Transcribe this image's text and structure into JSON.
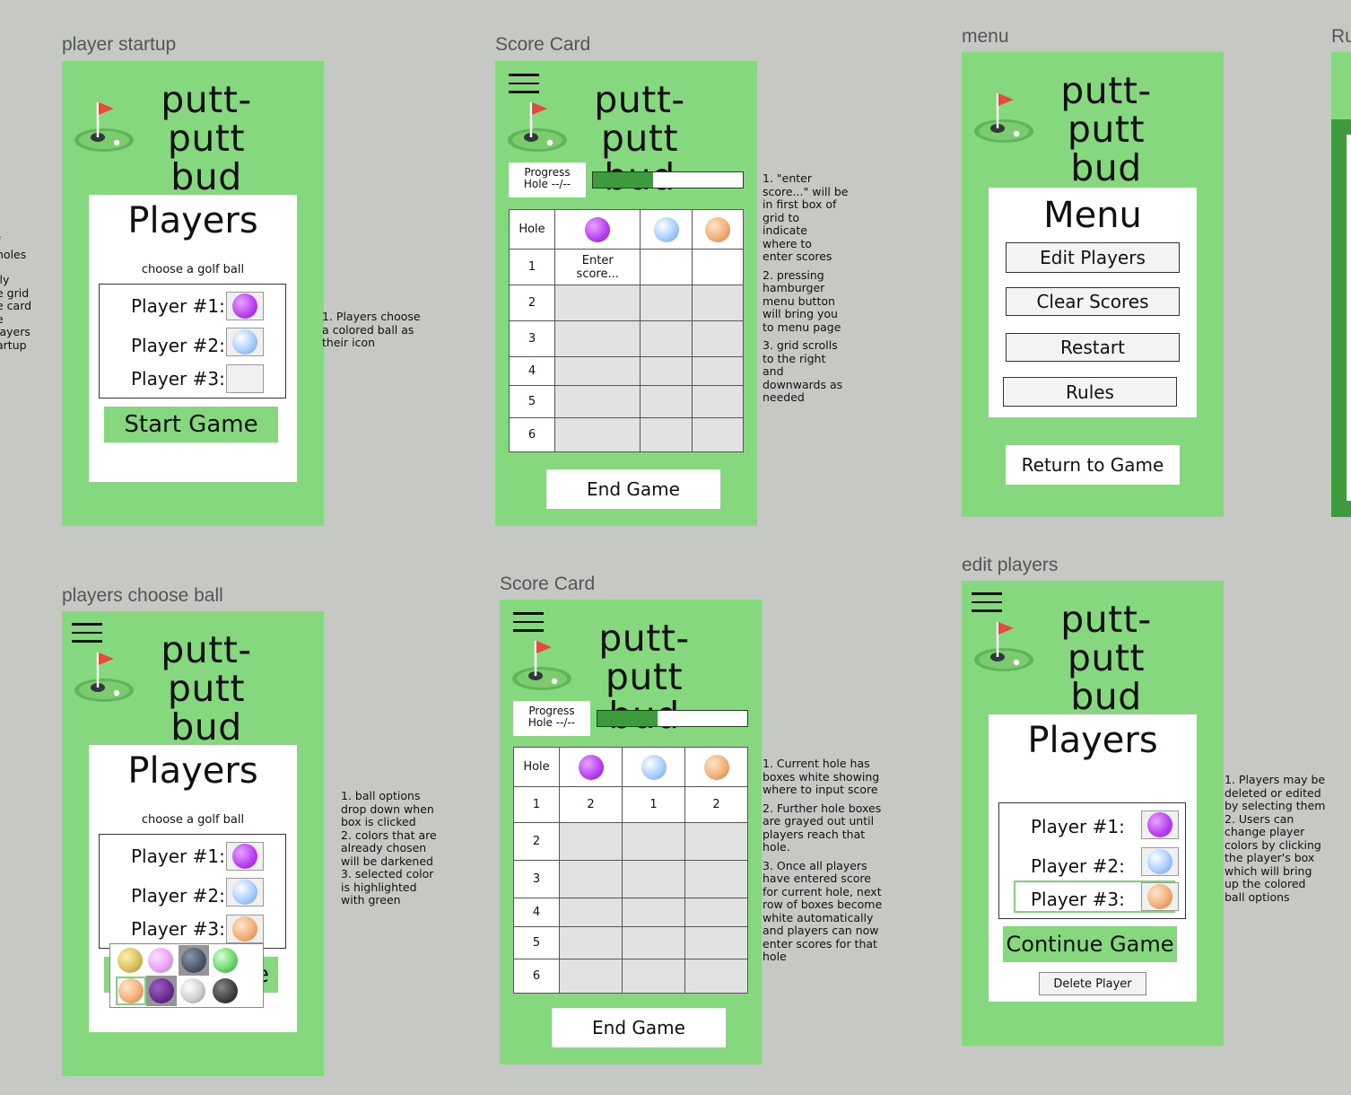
{
  "labels": {
    "startup": "player startup",
    "score1": "Score Card",
    "menu": "menu",
    "rules": "Ru",
    "choose": "players choose ball",
    "score2": "Score Card",
    "edit": "edit players"
  },
  "brand": {
    "line1": "putt-putt",
    "line2": "bud"
  },
  "players": {
    "title": "Players",
    "subtitle": "choose a golf ball",
    "p1": "Player #1:",
    "p2": "Player #2:",
    "p3": "Player #3:",
    "start": "Start Game",
    "continue": "Continue Game",
    "delete": "Delete Player"
  },
  "score": {
    "progress_line1": "Progress",
    "progress_line2": "Hole --/--",
    "progress_fraction": 0.4,
    "hole_header": "Hole",
    "holes": [
      "1",
      "2",
      "3",
      "4",
      "5",
      "6"
    ],
    "enter_line1": "Enter",
    "enter_line2": "score...",
    "row1_values": [
      "2",
      "1",
      "2"
    ],
    "end": "End Game"
  },
  "menu": {
    "title": "Menu",
    "items": [
      "Edit Players",
      "Clear Scores",
      "Restart",
      "Rules"
    ],
    "return": "Return to Game"
  },
  "notes": {
    "left_edge": [
      "f",
      "holes",
      "",
      "lly",
      "e grid",
      "e card",
      "e",
      "layers",
      "artup"
    ],
    "startup": [
      "1. Players choose",
      "a colored ball as",
      "their icon"
    ],
    "score1": [
      "1. \"enter",
      "score...\" will be",
      "in first box of",
      "grid to",
      "indicate",
      "where to",
      "enter scores",
      "",
      "2. pressing",
      "hamburger",
      "menu button",
      "will bring you",
      "to menu page",
      "",
      "3. grid scrolls",
      "to the right",
      "and",
      "downwards as",
      "needed"
    ],
    "choose": [
      "1. ball options",
      "drop down when",
      "box is clicked",
      "2. colors that are",
      "already chosen",
      "will be darkened",
      "3. selected color",
      "is highlighted",
      "with green"
    ],
    "score2": [
      "1. Current hole has",
      "boxes white showing",
      "where to input score",
      "",
      "2. Further hole boxes",
      "are grayed out until",
      "players reach that",
      "hole.",
      "",
      "3. Once all players",
      "have entered score",
      "for current hole, next",
      "row of boxes become",
      "white automatically",
      "and players can now",
      "enter scores for that",
      "hole"
    ],
    "edit": [
      "1. Players may be",
      "deleted or edited",
      "by selecting them",
      "2. Users can",
      "change player",
      "colors by clicking",
      "the player's box",
      "which will bring",
      "up the colored",
      "ball options"
    ]
  },
  "colors": {
    "frame_green": "#86d87f",
    "progress_green": "#3d9a3d",
    "highlight_green": "#7fd47a"
  },
  "icons": [
    "golf-flag-logo-icon",
    "hamburger-menu-icon",
    "golf-ball-icon"
  ]
}
